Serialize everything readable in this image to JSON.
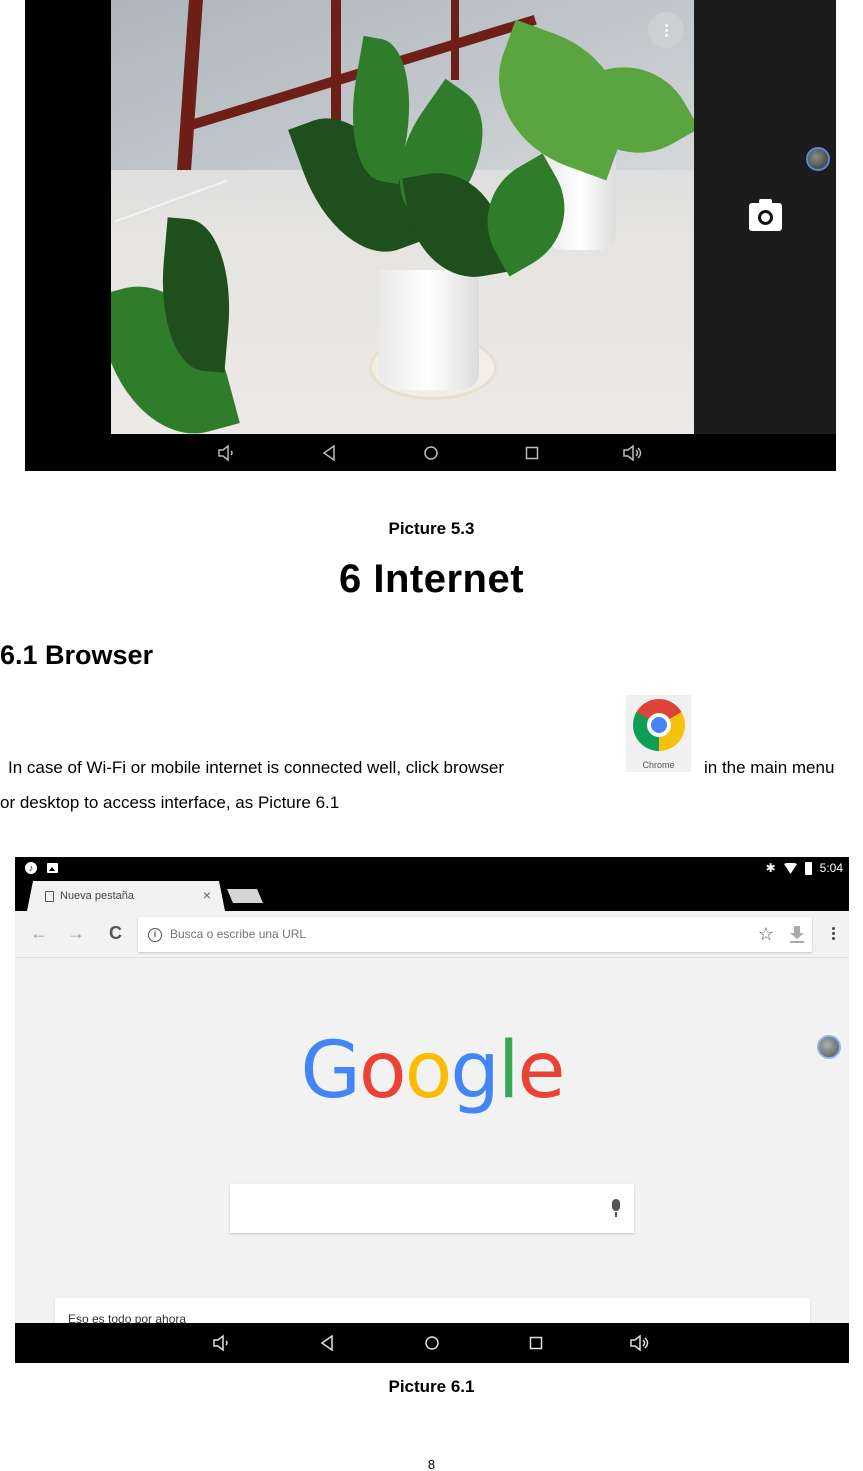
{
  "picture_5_3": {
    "caption": "Picture 5.3",
    "camera_app": {
      "more_options_icon": "vertical-dots",
      "gallery_thumbnail": "round-thumbnail",
      "shutter_icon": "camera-icon",
      "nav_bar": [
        "volume-down-icon",
        "back-icon",
        "home-icon",
        "recents-icon",
        "volume-up-icon"
      ]
    }
  },
  "chapter": {
    "title": "6 Internet",
    "section_title": "6.1 Browser",
    "paragraph_line1_before_icon": "In case of Wi-Fi or mobile internet is connected well, click browser",
    "paragraph_line1_after_icon": "in the main menu",
    "paragraph_line2": "or desktop to access interface, as Picture 6.1",
    "inline_app_icon": {
      "label": "Chrome",
      "colors": {
        "red": "#db4437",
        "yellow": "#f4c20d",
        "green": "#0f9d58",
        "blue": "#4285f4"
      }
    }
  },
  "picture_6_1": {
    "caption": "Picture 6.1",
    "status_bar": {
      "left_icons": [
        "music-icon",
        "image-icon"
      ],
      "right_icons": [
        "bluetooth-icon",
        "wifi-icon",
        "battery-icon"
      ],
      "time": "5:04"
    },
    "tab": {
      "title": "Nueva pestaña",
      "close_glyph": "×"
    },
    "toolbar": {
      "back_glyph": "←",
      "forward_glyph": "→",
      "reload_glyph": "C",
      "omnibox_info_glyph": "i",
      "omnibox_placeholder": "Busca o escribe una URL",
      "star_glyph": "☆"
    },
    "new_tab_page": {
      "logo_letters": [
        {
          "char": "G",
          "color": "#4285f4"
        },
        {
          "char": "o",
          "color": "#ea4335"
        },
        {
          "char": "o",
          "color": "#fbbc05"
        },
        {
          "char": "g",
          "color": "#4285f4"
        },
        {
          "char": "l",
          "color": "#34a853"
        },
        {
          "char": "e",
          "color": "#ea4335"
        }
      ],
      "search_placeholder": "",
      "card_text": "Eso es todo por ahora"
    },
    "nav_bar": [
      "volume-down-icon",
      "back-icon",
      "home-icon",
      "recents-icon",
      "volume-up-icon"
    ]
  },
  "footer": {
    "page_number": "8"
  }
}
